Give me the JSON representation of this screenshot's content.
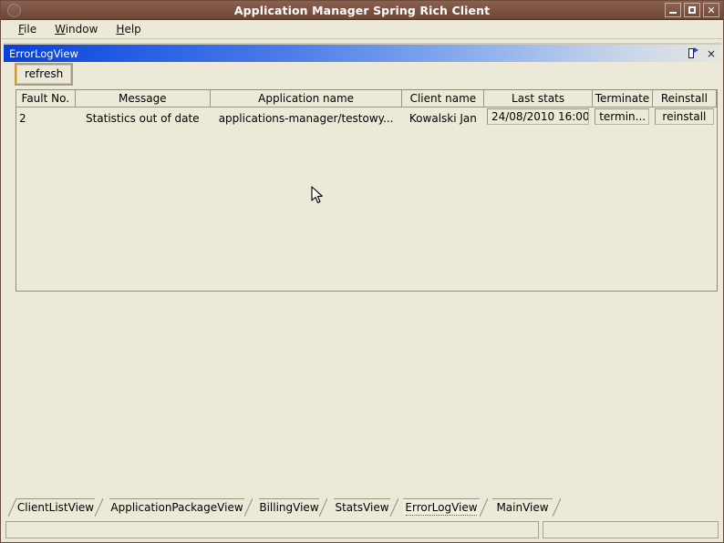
{
  "window": {
    "title": "Application Manager Spring Rich Client",
    "icon": "app-circle-icon",
    "controls": {
      "minimize": "minimize",
      "maximize": "maximize",
      "close": "close"
    }
  },
  "menubar": {
    "items": [
      {
        "label": "File",
        "mnemonic": "F"
      },
      {
        "label": "Window",
        "mnemonic": "W"
      },
      {
        "label": "Help",
        "mnemonic": "H"
      }
    ]
  },
  "internal_frame": {
    "title": "ErrorLogView",
    "controls": {
      "pin": "pin-icon",
      "close": "×"
    }
  },
  "toolbar": {
    "refresh_label": "refresh"
  },
  "table": {
    "columns": [
      "Fault No.",
      "Message",
      "Application name",
      "Client name",
      "Last stats",
      "Terminate",
      "Reinstall"
    ],
    "rows": [
      {
        "fault_no": "2",
        "message": "Statistics out of date",
        "application_name": "applications-manager/testowy...",
        "client_name": "Kowalski Jan",
        "last_stats": "24/08/2010 16:00",
        "terminate": "termin...",
        "reinstall": "reinstall"
      }
    ]
  },
  "tabs": {
    "selected": "ErrorLogView",
    "items": [
      "ClientListView",
      "ApplicationPackageView",
      "BillingView",
      "StatsView",
      "ErrorLogView",
      "MainView"
    ]
  },
  "statusbar": {
    "left_text": "",
    "right_text": ""
  },
  "colors": {
    "window_titlebar": "#7d5443",
    "frame_titlebar_start": "#0a3fd8",
    "frame_titlebar_end": "#e6e6dd",
    "desktop_bg": "#ece9d8",
    "focus_ring": "#c9a14c"
  }
}
